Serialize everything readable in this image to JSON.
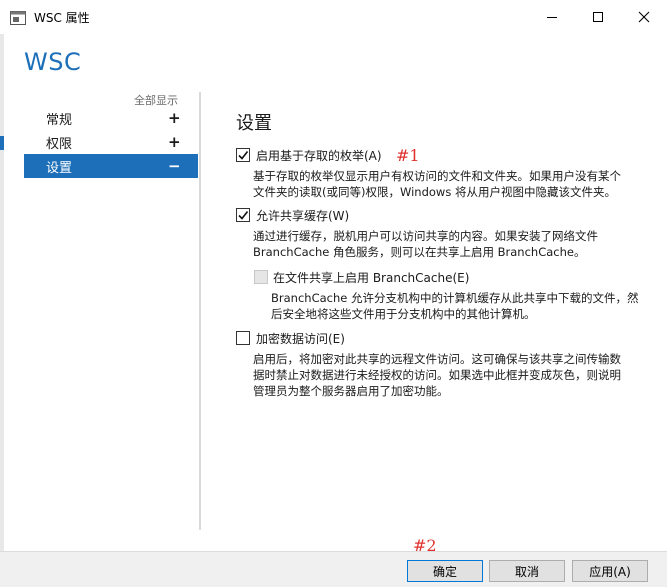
{
  "window": {
    "title": "WSC 属性",
    "controls": [
      "minimize-icon",
      "maximize-icon",
      "close-icon"
    ]
  },
  "header": {
    "title": "WSC"
  },
  "nav": {
    "show_all": "全部显示",
    "items": [
      {
        "label": "常规",
        "symbol": "+",
        "selected": false
      },
      {
        "label": "权限",
        "symbol": "+",
        "selected": false
      },
      {
        "label": "设置",
        "symbol": "−",
        "selected": true
      }
    ]
  },
  "settings": {
    "title": "设置",
    "abe": {
      "label": "启用基于存取的枚举(A)",
      "checked": true,
      "desc": [
        "基于存取的枚举仅显示用户有权访问的文件和文件夹。如果用户没有某个",
        "文件夹的读取(或同等)权限，Windows 将从用户视图中隐藏该文件夹。"
      ]
    },
    "cache": {
      "label": "允许共享缓存(W)",
      "checked": true,
      "desc": [
        "通过进行缓存，脱机用户可以访问共享的内容。如果安装了网络文件",
        "BranchCache 角色服务，则可以在共享上启用 BranchCache。"
      ]
    },
    "branchcache": {
      "label": "在文件共享上启用 BranchCache(E)",
      "checked": false,
      "disabled": true,
      "desc": [
        "BranchCache 允许分支机构中的计算机缓存从此共享中下载的文件，然",
        "后安全地将这些文件用于分支机构中的其他计算机。"
      ]
    },
    "encrypt": {
      "label": "加密数据访问(E)",
      "checked": false,
      "desc": [
        "启用后，将加密对此共享的远程文件访问。这可确保与该共享之间传输数",
        "据时禁止对数据进行未经授权的访问。如果选中此框并变成灰色，则说明",
        "管理员为整个服务器启用了加密功能。"
      ]
    }
  },
  "annotations": {
    "a1": "#1",
    "a2": "#2"
  },
  "footer": {
    "ok": "确定",
    "cancel": "取消",
    "apply": "应用(A)"
  },
  "colors": {
    "accent": "#1c6fb8",
    "annotation": "#e0332f",
    "footer_bg": "#f0f0f0"
  }
}
